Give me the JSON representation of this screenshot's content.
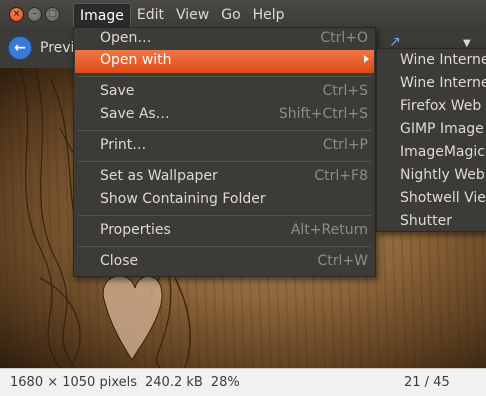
{
  "menubar": {
    "image": "Image",
    "edit": "Edit",
    "view": "View",
    "go": "Go",
    "help": "Help"
  },
  "toolbar": {
    "previous_label": "Previ"
  },
  "image_menu": {
    "items": [
      {
        "label": "Open…",
        "accel": "Ctrl+O"
      },
      {
        "label": "Open with",
        "accel": ""
      },
      {
        "label": "Save",
        "accel": "Ctrl+S"
      },
      {
        "label": "Save As…",
        "accel": "Shift+Ctrl+S"
      },
      {
        "label": "Print…",
        "accel": "Ctrl+P"
      },
      {
        "label": "Set as Wallpaper",
        "accel": "Ctrl+F8"
      },
      {
        "label": "Show Containing Folder",
        "accel": ""
      },
      {
        "label": "Properties",
        "accel": "Alt+Return"
      },
      {
        "label": "Close",
        "accel": "Ctrl+W"
      }
    ]
  },
  "open_with_submenu": {
    "items": [
      "Wine Interne",
      "Wine Interne",
      "Firefox Web B",
      "GIMP Image E",
      "ImageMagick",
      "Nightly Web",
      "Shotwell View",
      "Shutter"
    ]
  },
  "statusbar": {
    "dimensions": "1680 × 1050 pixels",
    "filesize": "240.2 kB",
    "zoom": "28%",
    "position": "21 / 45"
  },
  "colors": {
    "highlight": "#df4a16",
    "menu_bg": "#3c3b37",
    "accent_blue": "#3a7bd5"
  }
}
